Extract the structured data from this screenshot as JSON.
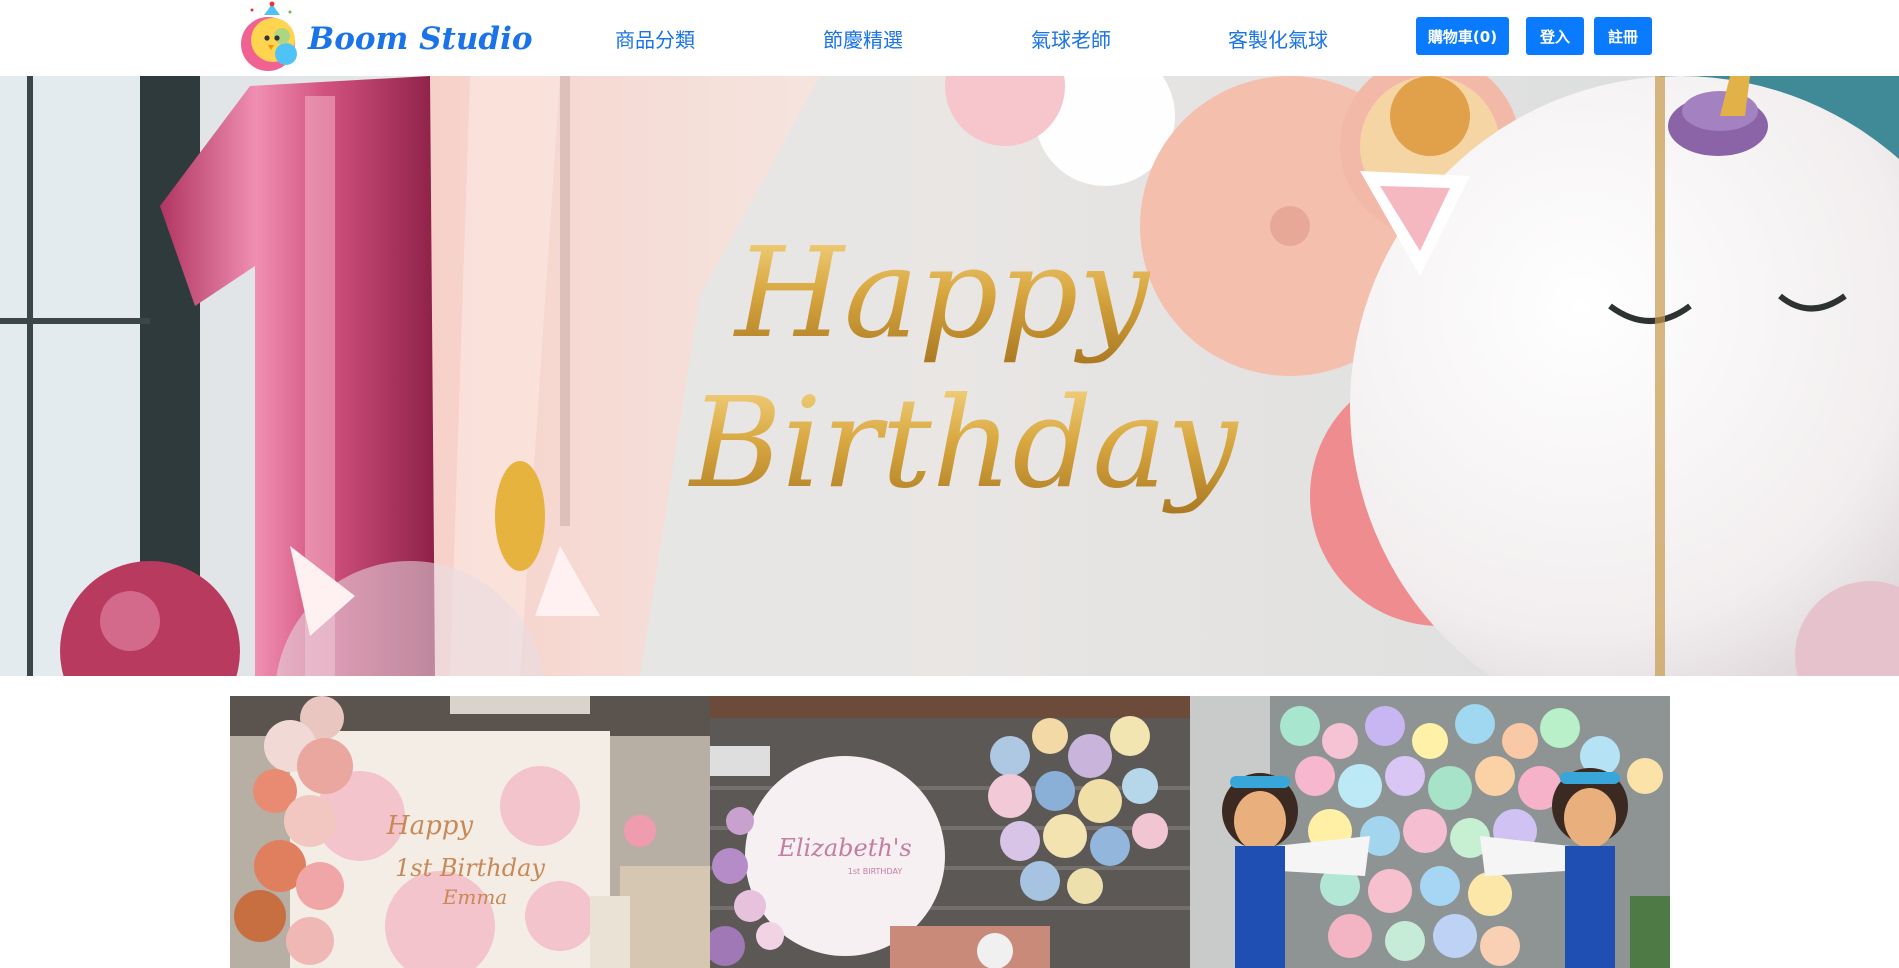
{
  "brand": {
    "name": "Boom Studio",
    "accent": "#1a73e8",
    "button_color": "#0a7bff"
  },
  "nav": {
    "items": [
      {
        "label": "商品分類"
      },
      {
        "label": "節慶精選"
      },
      {
        "label": "氣球老師"
      },
      {
        "label": "客製化氣球"
      }
    ]
  },
  "actions": {
    "cart_label": "購物車(0)",
    "login_label": "登入",
    "register_label": "註冊"
  },
  "hero": {
    "banner_text_line1": "Happy",
    "banner_text_line2": "Birthday"
  },
  "gallery": [
    {
      "line1": "Happy",
      "line2": "1st Birthday",
      "line3": "Emma"
    },
    {
      "line1": "Elizabeth's",
      "line2": "1st BIRTHDAY"
    },
    {}
  ]
}
